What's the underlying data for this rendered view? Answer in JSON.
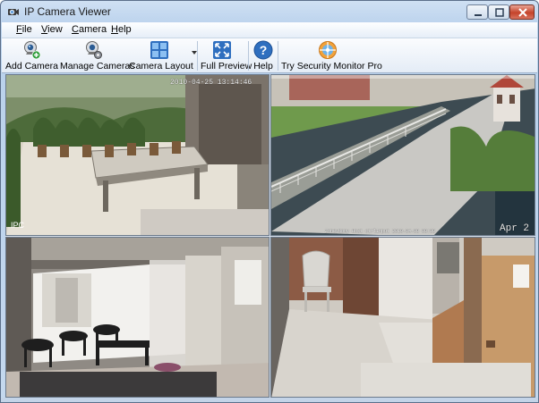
{
  "window": {
    "title": "IP Camera Viewer"
  },
  "menu": [
    {
      "id": "file",
      "label": "File"
    },
    {
      "id": "view",
      "label": "View"
    },
    {
      "id": "camera",
      "label": "Camera"
    },
    {
      "id": "help",
      "label": "Help"
    }
  ],
  "toolbar": {
    "add_camera": "Add Camera",
    "manage_cameras": "Manage Cameras",
    "camera_layout": "Camera Layout",
    "full_preview": "Full Preview",
    "help": "Help",
    "try_pro": "Try Security Monitor Pro"
  },
  "cameras": [
    {
      "id": "cam1",
      "timestamp": "2010-04-25 13:14:46",
      "label": "IPC"
    },
    {
      "id": "cam2",
      "timestamp": "ZoneyNony Host ctrlInput 2010-04-08 08:38",
      "label": "Apr 2"
    },
    {
      "id": "cam3",
      "timestamp": "",
      "label": ""
    },
    {
      "id": "cam4",
      "timestamp": "",
      "label": ""
    }
  ],
  "colors": {
    "accent": "#3b73b9",
    "title_bar": "#c4d8ee",
    "close_button": "#c5432a"
  },
  "icons": {
    "add_camera": "webcam-plus-icon",
    "manage_cameras": "webcam-gear-icon",
    "camera_layout": "grid-layout-icon",
    "full_preview": "expand-arrows-icon",
    "help": "question-icon",
    "try_pro": "target-icon"
  }
}
